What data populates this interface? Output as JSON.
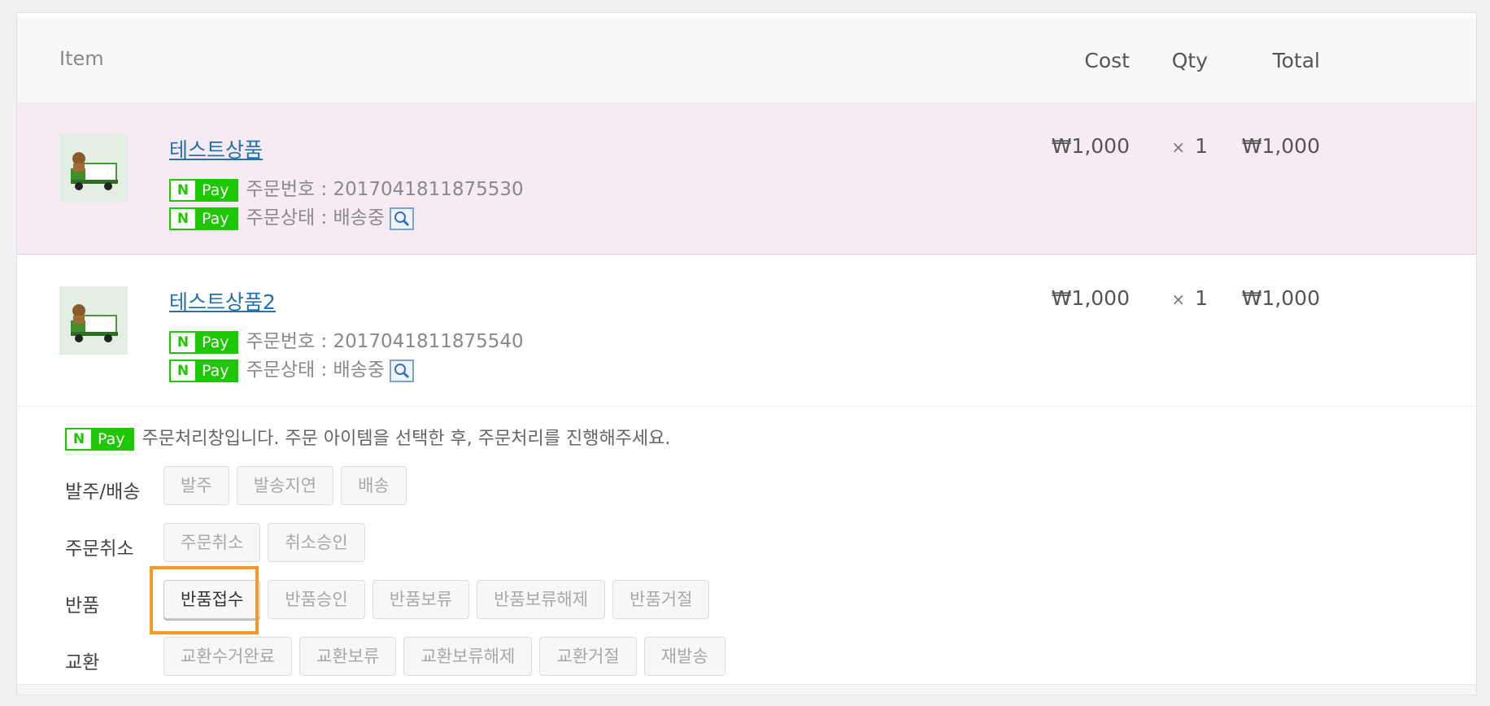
{
  "table": {
    "headers": {
      "item": "Item",
      "cost": "Cost",
      "qty": "Qty",
      "total": "Total"
    },
    "rows": [
      {
        "name": "테스트상품",
        "order_number": "주문번호 : 2017041811875530",
        "order_status": "주문상태 : 배송중",
        "cost": "₩1,000",
        "qty_symbol": "×",
        "qty": "1",
        "total": "₩1,000"
      },
      {
        "name": "테스트상품2",
        "order_number": "주문번호 : 2017041811875540",
        "order_status": "주문상태 : 배송중",
        "cost": "₩1,000",
        "qty_symbol": "×",
        "qty": "1",
        "total": "₩1,000"
      }
    ]
  },
  "npay": {
    "n": "N",
    "pay": "Pay",
    "color": "#1ec800"
  },
  "process": {
    "notice": "주문처리창입니다. 주문 아이템을 선택한 후, 주문처리를 진행해주세요.",
    "groups": [
      {
        "label": "발주/배송",
        "buttons": [
          "발주",
          "발송지연",
          "배송"
        ]
      },
      {
        "label": "주문취소",
        "buttons": [
          "주문취소",
          "취소승인"
        ]
      },
      {
        "label": "반품",
        "buttons": [
          "반품접수",
          "반품승인",
          "반품보류",
          "반품보류해제",
          "반품거절"
        ]
      },
      {
        "label": "교환",
        "buttons": [
          "교환수거완료",
          "교환보류",
          "교환보류해제",
          "교환거절",
          "재발송"
        ]
      }
    ],
    "highlight_color": "#f39a2e"
  }
}
